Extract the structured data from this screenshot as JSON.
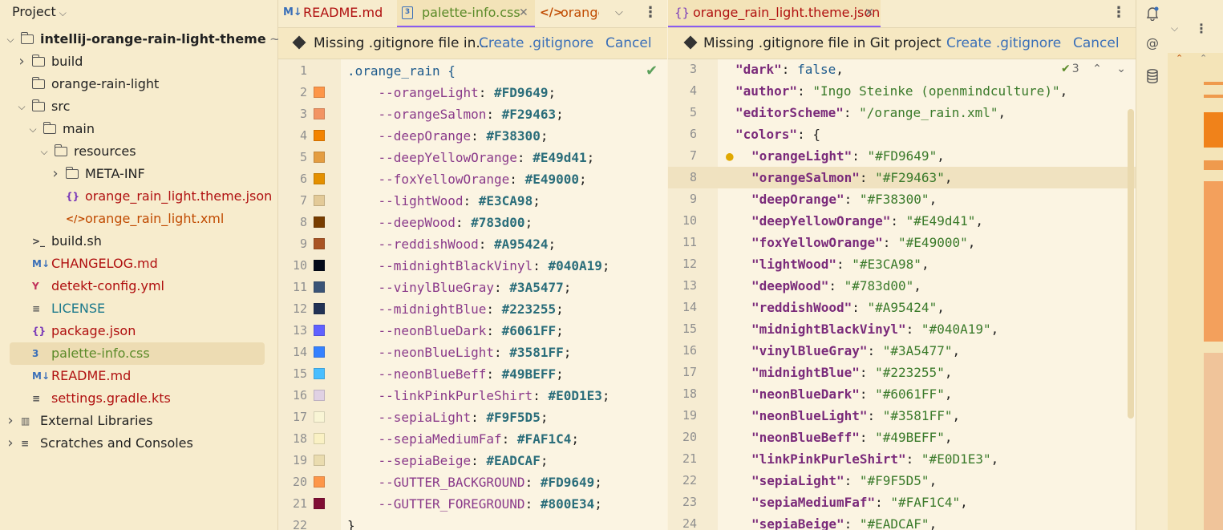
{
  "project": {
    "header": "Project",
    "rows": [
      {
        "label": "intellij-orange-rain-light-theme",
        "suffix": "~",
        "indent": 0,
        "arrow": "v",
        "icon": "folder",
        "color": "c-dark",
        "bold": true
      },
      {
        "label": "build",
        "indent": 1,
        "arrow": ">",
        "icon": "folder",
        "color": "c-dark"
      },
      {
        "label": "orange-rain-light",
        "indent": 1,
        "arrow": "",
        "icon": "folder",
        "color": "c-dark"
      },
      {
        "label": "src",
        "indent": 1,
        "arrow": "v",
        "icon": "folder",
        "color": "c-dark"
      },
      {
        "label": "main",
        "indent": 2,
        "arrow": "v",
        "icon": "folder",
        "color": "c-dark"
      },
      {
        "label": "resources",
        "indent": 3,
        "arrow": "v",
        "icon": "folder",
        "color": "c-dark"
      },
      {
        "label": "META-INF",
        "indent": 4,
        "arrow": ">",
        "icon": "folder",
        "color": "c-dark"
      },
      {
        "label": "orange_rain_light.theme.json",
        "indent": 4,
        "arrow": "",
        "icon": "json",
        "color": "c-red"
      },
      {
        "label": "orange_rain_light.xml",
        "indent": 4,
        "arrow": "",
        "icon": "xml",
        "color": "c-orange"
      },
      {
        "label": "build.sh",
        "indent": 1,
        "arrow": "",
        "icon": "shell",
        "color": "c-dark"
      },
      {
        "label": "CHANGELOG.md",
        "indent": 1,
        "arrow": "",
        "icon": "md",
        "color": "c-red"
      },
      {
        "label": "detekt-config.yml",
        "indent": 1,
        "arrow": "",
        "icon": "yml",
        "color": "c-red"
      },
      {
        "label": "LICENSE",
        "indent": 1,
        "arrow": "",
        "icon": "text",
        "color": "c-teal"
      },
      {
        "label": "package.json",
        "indent": 1,
        "arrow": "",
        "icon": "json",
        "color": "c-red"
      },
      {
        "label": "palette-info.css",
        "indent": 1,
        "arrow": "",
        "icon": "css",
        "color": "c-green",
        "selected": true
      },
      {
        "label": "README.md",
        "indent": 1,
        "arrow": "",
        "icon": "md",
        "color": "c-red"
      },
      {
        "label": "settings.gradle.kts",
        "indent": 1,
        "arrow": "",
        "icon": "text",
        "color": "c-red"
      },
      {
        "label": "External Libraries",
        "indent": 0,
        "arrow": ">",
        "icon": "lib",
        "color": "c-dark"
      },
      {
        "label": "Scratches and Consoles",
        "indent": 0,
        "arrow": ">",
        "icon": "scratch",
        "color": "c-dark"
      }
    ]
  },
  "left_tabs": [
    {
      "label": "README.md",
      "icon": "M↓"
    },
    {
      "label": "palette-info.css",
      "icon": "css",
      "active": true
    },
    {
      "label": "orange",
      "icon": "</>"
    }
  ],
  "right_tabs": [
    {
      "label": "orange_rain_light.theme.json",
      "icon": "{}",
      "active": true
    }
  ],
  "left_notice": {
    "text": "Missing .gitignore file in...",
    "create": "Create .gitignore",
    "cancel": "Cancel"
  },
  "right_notice": {
    "text": "Missing .gitignore file in Git project",
    "create": "Create .gitignore",
    "cancel": "Cancel"
  },
  "css_editor": {
    "class_line": ".orange_rain {",
    "entries": [
      {
        "n": "2",
        "prop": "--orangeLight",
        "val": "#FD9649"
      },
      {
        "n": "3",
        "prop": "--orangeSalmon",
        "val": "#F29463"
      },
      {
        "n": "4",
        "prop": "--deepOrange",
        "val": "#F38300"
      },
      {
        "n": "5",
        "prop": "--deepYellowOrange",
        "val": "#E49d41"
      },
      {
        "n": "6",
        "prop": "--foxYellowOrange",
        "val": "#E49000"
      },
      {
        "n": "7",
        "prop": "--lightWood",
        "val": "#E3CA98"
      },
      {
        "n": "8",
        "prop": "--deepWood",
        "val": "#783d00"
      },
      {
        "n": "9",
        "prop": "--reddishWood",
        "val": "#A95424"
      },
      {
        "n": "10",
        "prop": "--midnightBlackVinyl",
        "val": "#040A19"
      },
      {
        "n": "11",
        "prop": "--vinylBlueGray",
        "val": "#3A5477"
      },
      {
        "n": "12",
        "prop": "--midnightBlue",
        "val": "#223255"
      },
      {
        "n": "13",
        "prop": "--neonBlueDark",
        "val": "#6061FF"
      },
      {
        "n": "14",
        "prop": "--neonBlueLight",
        "val": "#3581FF"
      },
      {
        "n": "15",
        "prop": "--neonBlueBeff",
        "val": "#49BEFF"
      },
      {
        "n": "16",
        "prop": "--linkPinkPurleShirt",
        "val": "#E0D1E3"
      },
      {
        "n": "17",
        "prop": "--sepiaLight",
        "val": "#F9F5D5"
      },
      {
        "n": "18",
        "prop": "--sepiaMediumFaf",
        "val": "#FAF1C4"
      },
      {
        "n": "19",
        "prop": "--sepiaBeige",
        "val": "#EADCAF"
      },
      {
        "n": "20",
        "prop": "--GUTTER_BACKGROUND",
        "val": "#FD9649"
      },
      {
        "n": "21",
        "prop": "--GUTTER_FOREGROUND",
        "val": "#800E34"
      }
    ],
    "first_n": "1",
    "last_n": "22",
    "last_text": "}"
  },
  "json_editor": {
    "top": [
      {
        "n": "3",
        "key": "\"dark\"",
        "val": "false",
        "kw": true
      },
      {
        "n": "4",
        "key": "\"author\"",
        "val": "\"Ingo Steinke (openmindculture)\""
      },
      {
        "n": "5",
        "key": "\"editorScheme\"",
        "val": "\"/orange_rain.xml\""
      },
      {
        "n": "6",
        "key": "\"colors\"",
        "val": "{",
        "brace": true
      }
    ],
    "colors": [
      {
        "n": "7",
        "key": "\"orangeLight\"",
        "val": "\"#FD9649\""
      },
      {
        "n": "8",
        "key": "\"orangeSalmon\"",
        "val": "\"#F29463\"",
        "sel": true
      },
      {
        "n": "9",
        "key": "\"deepOrange\"",
        "val": "\"#F38300\""
      },
      {
        "n": "10",
        "key": "\"deepYellowOrange\"",
        "val": "\"#E49d41\""
      },
      {
        "n": "11",
        "key": "\"foxYellowOrange\"",
        "val": "\"#E49000\""
      },
      {
        "n": "12",
        "key": "\"lightWood\"",
        "val": "\"#E3CA98\""
      },
      {
        "n": "13",
        "key": "\"deepWood\"",
        "val": "\"#783d00\""
      },
      {
        "n": "14",
        "key": "\"reddishWood\"",
        "val": "\"#A95424\""
      },
      {
        "n": "15",
        "key": "\"midnightBlackVinyl\"",
        "val": "\"#040A19\""
      },
      {
        "n": "16",
        "key": "\"vinylBlueGray\"",
        "val": "\"#3A5477\""
      },
      {
        "n": "17",
        "key": "\"midnightBlue\"",
        "val": "\"#223255\""
      },
      {
        "n": "18",
        "key": "\"neonBlueDark\"",
        "val": "\"#6061FF\""
      },
      {
        "n": "19",
        "key": "\"neonBlueLight\"",
        "val": "\"#3581FF\""
      },
      {
        "n": "20",
        "key": "\"neonBlueBeff\"",
        "val": "\"#49BEFF\""
      },
      {
        "n": "21",
        "key": "\"linkPinkPurleShirt\"",
        "val": "\"#E0D1E3\""
      },
      {
        "n": "22",
        "key": "\"sepiaLight\"",
        "val": "\"#F9F5D5\""
      },
      {
        "n": "23",
        "key": "\"sepiaMediumFaf\"",
        "val": "\"#FAF1C4\""
      },
      {
        "n": "24",
        "key": "\"sepiaBeige\"",
        "val": "\"#EADCAF\""
      }
    ],
    "inspection_count": "3"
  }
}
